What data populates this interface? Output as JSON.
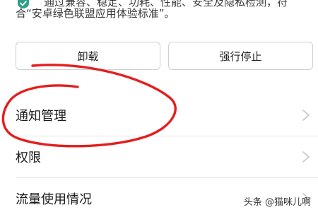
{
  "notice": {
    "line1": "通过兼容、稳定、功耗、性能、安全及隐私检测，符",
    "line2": "合“安卓绿色联盟应用体验标准”。",
    "icon": "shield-check-icon",
    "icon_color": "#2f9e88"
  },
  "actions": {
    "uninstall_label": "卸载",
    "force_stop_label": "强行停止"
  },
  "menu": {
    "items": [
      {
        "label": "通知管理",
        "icon": "chevron-right-icon"
      },
      {
        "label": "权限",
        "icon": "chevron-right-icon"
      },
      {
        "label": "流量使用情况",
        "icon": "chevron-right-icon"
      }
    ]
  },
  "annotation": {
    "shape": "hand-drawn red circle around 通知管理",
    "color": "#e41e1e"
  },
  "watermark": {
    "text": "头条 @猫咪儿啊"
  }
}
